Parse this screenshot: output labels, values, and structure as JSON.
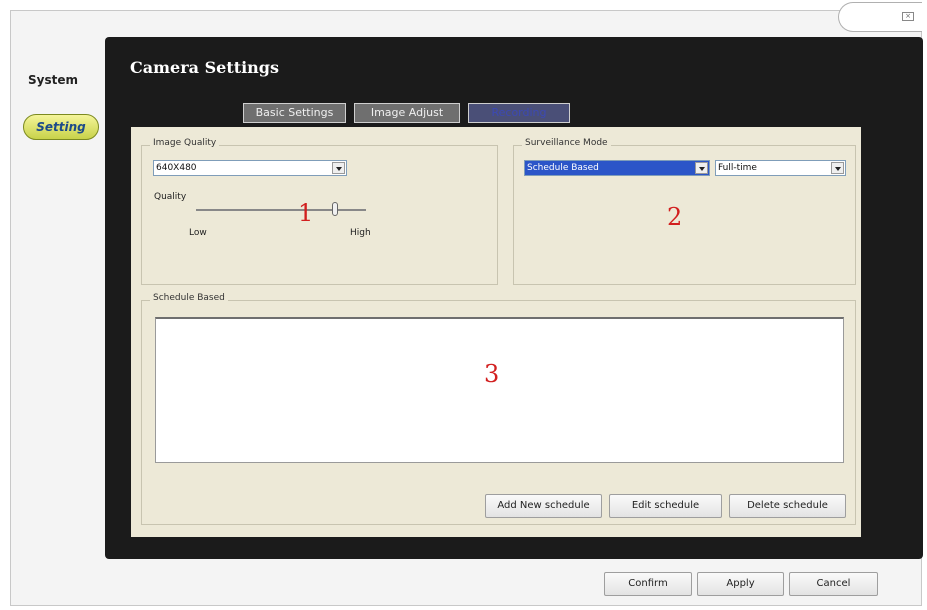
{
  "sidebar": {
    "system_label": "System",
    "setting_label": "Setting"
  },
  "window": {
    "title": "Camera Settings",
    "close_icon": "close-icon"
  },
  "tabs": [
    {
      "label": "Basic Settings",
      "active": false
    },
    {
      "label": "Image Adjust",
      "active": false
    },
    {
      "label": "Recording",
      "active": true
    }
  ],
  "image_quality": {
    "group_label": "Image Quality",
    "resolution_value": "640X480",
    "quality_label": "Quality",
    "low_label": "Low",
    "high_label": "High",
    "slider_level": 0.82
  },
  "surveillance_mode": {
    "group_label": "Surveillance Mode",
    "mode_value": "Schedule Based",
    "time_value": "Full-time"
  },
  "schedule": {
    "group_label": "Schedule Based",
    "add_label": "Add New schedule",
    "edit_label": "Edit schedule",
    "delete_label": "Delete schedule"
  },
  "annotations": [
    "1",
    "2",
    "3"
  ],
  "footer": {
    "confirm_label": "Confirm",
    "apply_label": "Apply",
    "cancel_label": "Cancel"
  },
  "colors": {
    "dark_panel": "#1b1b1b",
    "content_bg": "#ede9d7",
    "annotation_red": "#d21f1f",
    "active_tab_text": "#3c49b4",
    "selection_blue": "#2b55c8"
  }
}
